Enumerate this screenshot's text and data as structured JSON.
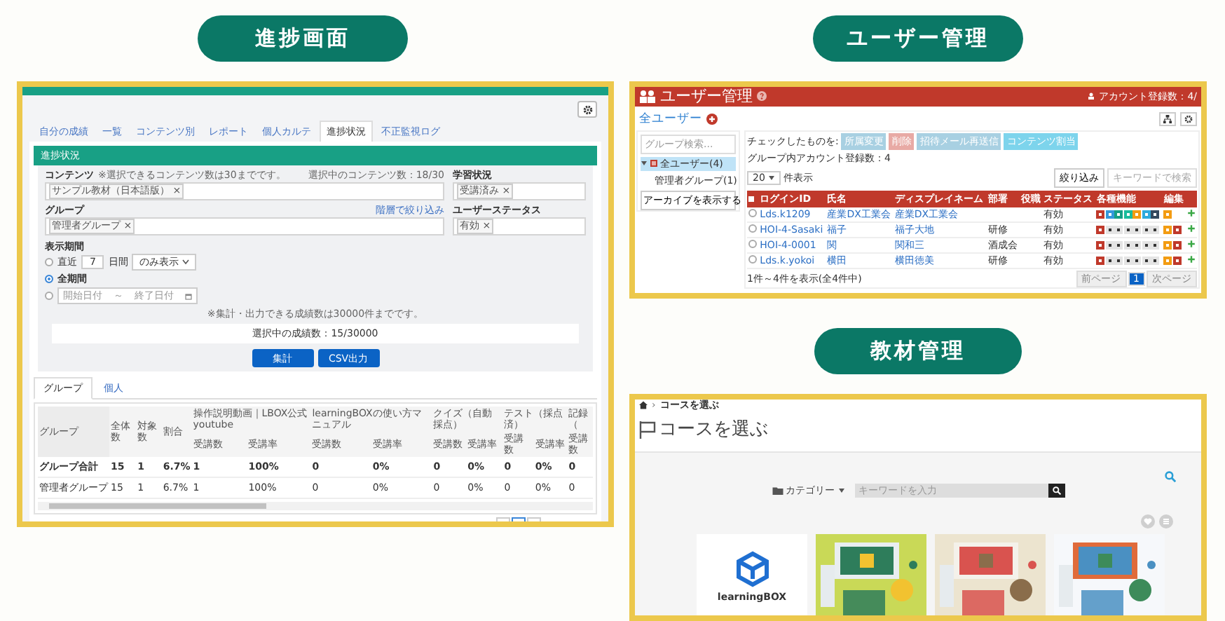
{
  "progress": {
    "heading": "進捗画面",
    "tabs": [
      {
        "label": "自分の成績",
        "selected": false
      },
      {
        "label": "一覧",
        "selected": false
      },
      {
        "label": "コンテンツ別",
        "selected": false
      },
      {
        "label": "レポート",
        "selected": false
      },
      {
        "label": "個人カルテ",
        "selected": false
      },
      {
        "label": "進捗状況",
        "selected": true
      },
      {
        "label": "不正監視ログ",
        "selected": false
      }
    ],
    "panel_title": "進捗状況",
    "content_label": "コンテンツ",
    "content_note": "※選択できるコンテンツ数は30までです。",
    "content_count": "選択中のコンテンツ数：18/30",
    "content_tags": [
      "サンプル教材（日本語版） ×"
    ],
    "study_label": "学習状況",
    "study_tags": [
      "受講済み ×"
    ],
    "group_label": "グループ",
    "group_link": "階層で絞り込み",
    "group_tags": [
      "管理者グループ ×"
    ],
    "status_label": "ユーザーステータス",
    "status_tags": [
      "有効 ×"
    ],
    "period_label": "表示期間",
    "period_options": [
      {
        "kind": "recent",
        "selected": false,
        "prefix": "直近",
        "value": "7",
        "suffix": "日間",
        "select": "のみ表示"
      },
      {
        "kind": "all",
        "selected": true,
        "label": "全期間"
      },
      {
        "kind": "range",
        "selected": false,
        "start_placeholder": "開始日付",
        "separator": "～",
        "end_placeholder": "終了日付"
      }
    ],
    "limit_note": "※集計・出力できる成績数は30000件までです。",
    "selected_count": "選択中の成績数：15/30000",
    "buttons": [
      "集計",
      "CSV出力"
    ],
    "result_tabs": [
      {
        "label": "グループ",
        "selected": true
      },
      {
        "label": "個人",
        "selected": false
      }
    ],
    "table": {
      "group_header": "グループ",
      "stat_headers": [
        "全体数",
        "対象数",
        "割合"
      ],
      "content_headers": [
        "操作説明動画｜LBOX公式youtube",
        "learningBOXの使い方マニュアル",
        "クイズ（自動採点）",
        "テスト（採点済）",
        "記録（"
      ],
      "sub_headers": [
        "受講数",
        "受講率",
        "受講数",
        "受講率",
        "受講数",
        "受講率",
        "受講数",
        "受講率",
        "受講数"
      ],
      "rows": [
        {
          "kind": "total",
          "cells": [
            "グループ合計",
            "15",
            "1",
            "6.7%",
            "1",
            "100%",
            "0",
            "0%",
            "0",
            "0%",
            "0",
            "0%",
            "0"
          ]
        },
        {
          "kind": "group",
          "cells": [
            "管理者グループ",
            "15",
            "1",
            "6.7%",
            "1",
            "100%",
            "0",
            "0%",
            "0",
            "0%",
            "0",
            "0%",
            "0"
          ]
        }
      ]
    }
  },
  "users": {
    "heading": "ユーザー管理",
    "title": "ユーザー管理",
    "account_count": "アカウント登録数：4/",
    "page_title": "全ユーザー",
    "group_search_placeholder": "グループ検索...",
    "tree": [
      {
        "label": "全ユーザー(4)",
        "selected": true,
        "expanded": true,
        "children": [
          {
            "label": "管理者グループ(1)",
            "selected": false
          }
        ]
      }
    ],
    "archive_button": "アーカイブを表示する",
    "bulk_label": "チェックしたものを:",
    "bulk_buttons": [
      {
        "label": "所属変更",
        "color": "#a8d0e2"
      },
      {
        "label": "削除",
        "color": "#e8aaa5"
      },
      {
        "label": "招待メール再送信",
        "color": "#a8d0e2"
      },
      {
        "label": "コンテンツ割当",
        "color": "#7dd4ec"
      }
    ],
    "group_count": "グループ内アカウント登録数：4",
    "page_size": "20",
    "page_size_suffix": "件表示",
    "filter_button": "絞り込み",
    "keyword_placeholder": "キーワードで検索",
    "all_checked": false,
    "columns": [
      "ログインID",
      "氏名",
      "ディスプレイネーム",
      "部署",
      "役職",
      "ステータス",
      "各種機能",
      "編集"
    ],
    "rows": [
      {
        "checked": false,
        "login": "Lds.k1209",
        "name": "産業DX工業会",
        "display": "産業DX工業会",
        "status": "有効",
        "highlighted": true,
        "deletable": false
      },
      {
        "checked": false,
        "login": "HOI-4-Sasaki",
        "name": "福子",
        "display": "福子大地",
        "dept": "研修",
        "status": "有効",
        "highlighted": false,
        "deletable": true
      },
      {
        "checked": false,
        "login": "HOI-4-0001",
        "name": "関",
        "display": "関和三",
        "dept": "酒成会",
        "status": "有効",
        "highlighted": false,
        "deletable": true
      },
      {
        "checked": false,
        "login": "Lds.k.yokoi",
        "name": "横田",
        "display": "横田徳美",
        "dept": "研修",
        "status": "有効",
        "highlighted": false,
        "deletable": true
      }
    ],
    "summary": "1件～4件を表示(全4件中)",
    "pager": [
      {
        "label": "前ページ",
        "selected": false
      },
      {
        "label": "1",
        "selected": true
      },
      {
        "label": "次ページ",
        "selected": false
      }
    ]
  },
  "courses": {
    "heading": "教材管理",
    "breadcrumb_separator": "›",
    "breadcrumb": "コースを選ぶ",
    "title": "コースを選ぶ",
    "category": "カテゴリー",
    "keyword_placeholder": "キーワードを入力",
    "cards": [
      {
        "kind": "logo",
        "label": "learningBOX"
      },
      {
        "kind": "picture"
      },
      {
        "kind": "picture"
      },
      {
        "kind": "picture"
      }
    ]
  }
}
